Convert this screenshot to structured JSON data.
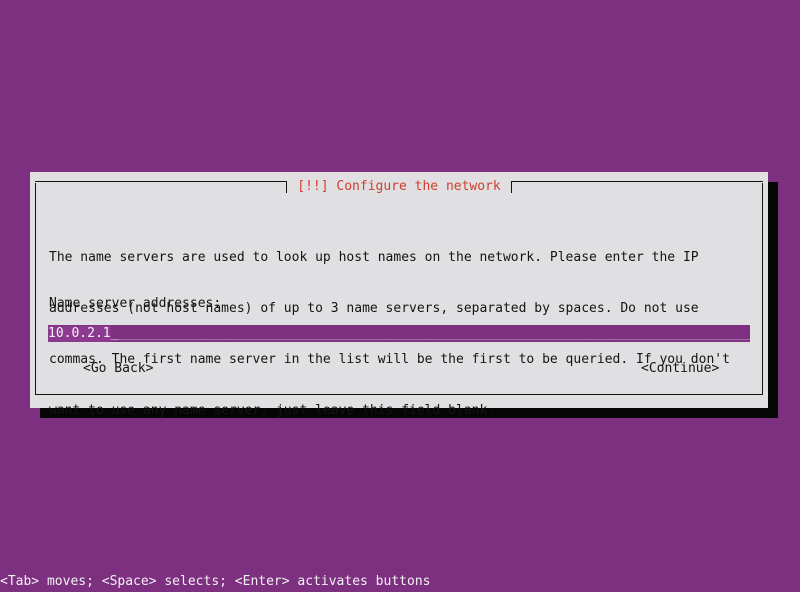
{
  "screen": {
    "background_color": "#7d2f80"
  },
  "dialog": {
    "title": "[!!] Configure the network",
    "title_color": "#d33c2e",
    "background_color": "#e0e0e2",
    "border_color": "#141414",
    "paragraph": [
      "The name servers are used to look up host names on the network. Please enter the IP",
      "addresses (not host names) of up to 3 name servers, separated by spaces. Do not use",
      "commas. The first name server in the list will be the first to be queried. If you don't",
      "want to use any name server, just leave this field blank."
    ],
    "field": {
      "label": "Name server addresses:",
      "value": "10.0.2.1",
      "placeholder": "",
      "caret": "_",
      "fill": "____________________________________________________________________________________________________________________",
      "field_background": "#7d2f80",
      "value_background": "#8c3a8f",
      "value_color": "#f4f4f4"
    },
    "buttons": {
      "go_back": "<Go Back>",
      "continue": "<Continue>"
    }
  },
  "statusbar": {
    "text": "<Tab> moves; <Space> selects; <Enter> activates buttons"
  }
}
